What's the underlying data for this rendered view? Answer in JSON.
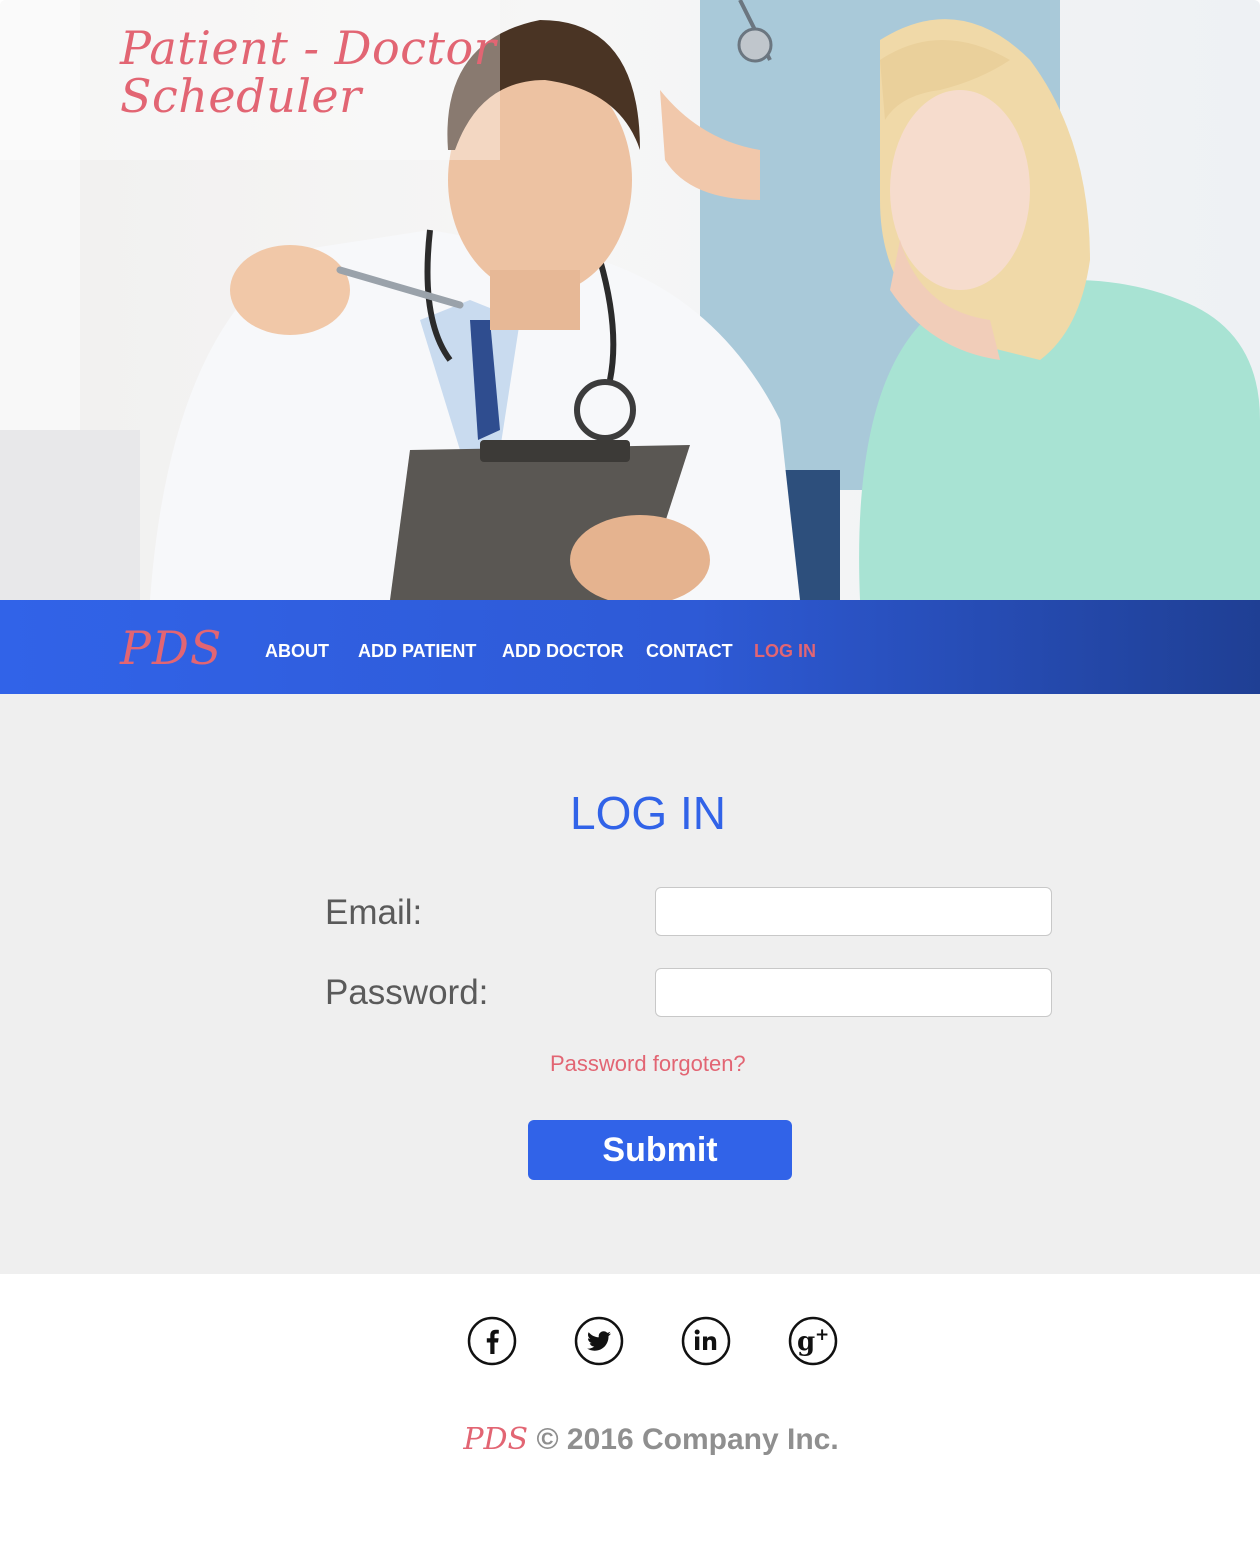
{
  "hero": {
    "title": "Patient - Doctor Scheduler"
  },
  "nav": {
    "logo": "PDS",
    "items": [
      {
        "label": "ABOUT",
        "active": false
      },
      {
        "label": "ADD PATIENT",
        "active": false
      },
      {
        "label": "ADD DOCTOR",
        "active": false
      },
      {
        "label": "CONTACT",
        "active": false
      },
      {
        "label": "LOG IN",
        "active": true
      }
    ]
  },
  "login": {
    "title": "LOG IN",
    "email_label": "Email:",
    "email_value": "",
    "password_label": "Password:",
    "password_value": "",
    "forgot_label": "Password forgoten?",
    "submit_label": "Submit"
  },
  "footer": {
    "social": [
      "facebook-icon",
      "twitter-icon",
      "linkedin-icon",
      "google-plus-icon"
    ],
    "logo": "PDS",
    "copyright": "© 2016 Company Inc."
  },
  "colors": {
    "primary": "#3163e8",
    "accent": "#e26573",
    "nav_dark": "#1f3f94",
    "main_bg": "#efefef",
    "label_gray": "#5a5a5a",
    "footer_gray": "#8f8f8f"
  }
}
